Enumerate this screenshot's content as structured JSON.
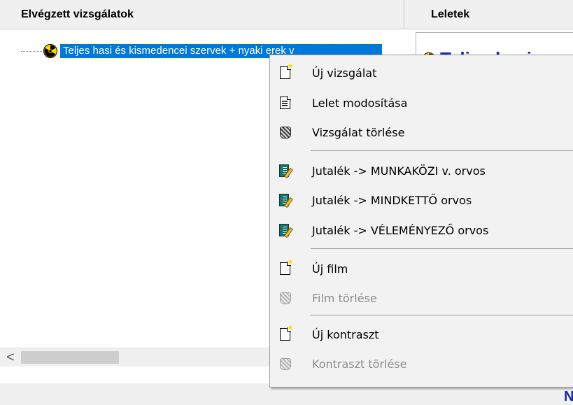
{
  "left_panel": {
    "header": "Elvégzett vizsgálatok",
    "tree_item": "Teljes hasi és kismedencei szervek + nyaki erek v"
  },
  "right_panel": {
    "header": "Leletek",
    "title_partial": "Teljes hasi",
    "status_partial": "N"
  },
  "scrollbar": {
    "left_arrow": "<"
  },
  "context_menu": {
    "items": [
      {
        "label": "Új vizsgálat",
        "icon": "new-document-icon",
        "enabled": true
      },
      {
        "label": "Lelet modosítása",
        "icon": "edit-document-icon",
        "enabled": true
      },
      {
        "label": "Vizsgálat törlése",
        "icon": "trash-icon",
        "enabled": true
      },
      {
        "label": "Jutalék -> MUNKAKÖZI v. orvos",
        "icon": "book-pencil-icon",
        "enabled": true
      },
      {
        "label": "Jutalék -> MINDKETTŐ orvos",
        "icon": "book-pencil-icon",
        "enabled": true
      },
      {
        "label": "Jutalék -> VÉLEMÉNYEZŐ orvos",
        "icon": "book-pencil-icon",
        "enabled": true
      },
      {
        "label": "Új film",
        "icon": "new-document-icon",
        "enabled": true
      },
      {
        "label": "Film törlése",
        "icon": "trash-icon",
        "enabled": false
      },
      {
        "label": "Új kontraszt",
        "icon": "new-document-icon",
        "enabled": true
      },
      {
        "label": "Kontraszt törlése",
        "icon": "trash-icon",
        "enabled": false
      }
    ]
  },
  "colors": {
    "selection": "#0078d7",
    "title_blue": "#1a2aa8",
    "radiation_yellow": "#ffd800"
  }
}
